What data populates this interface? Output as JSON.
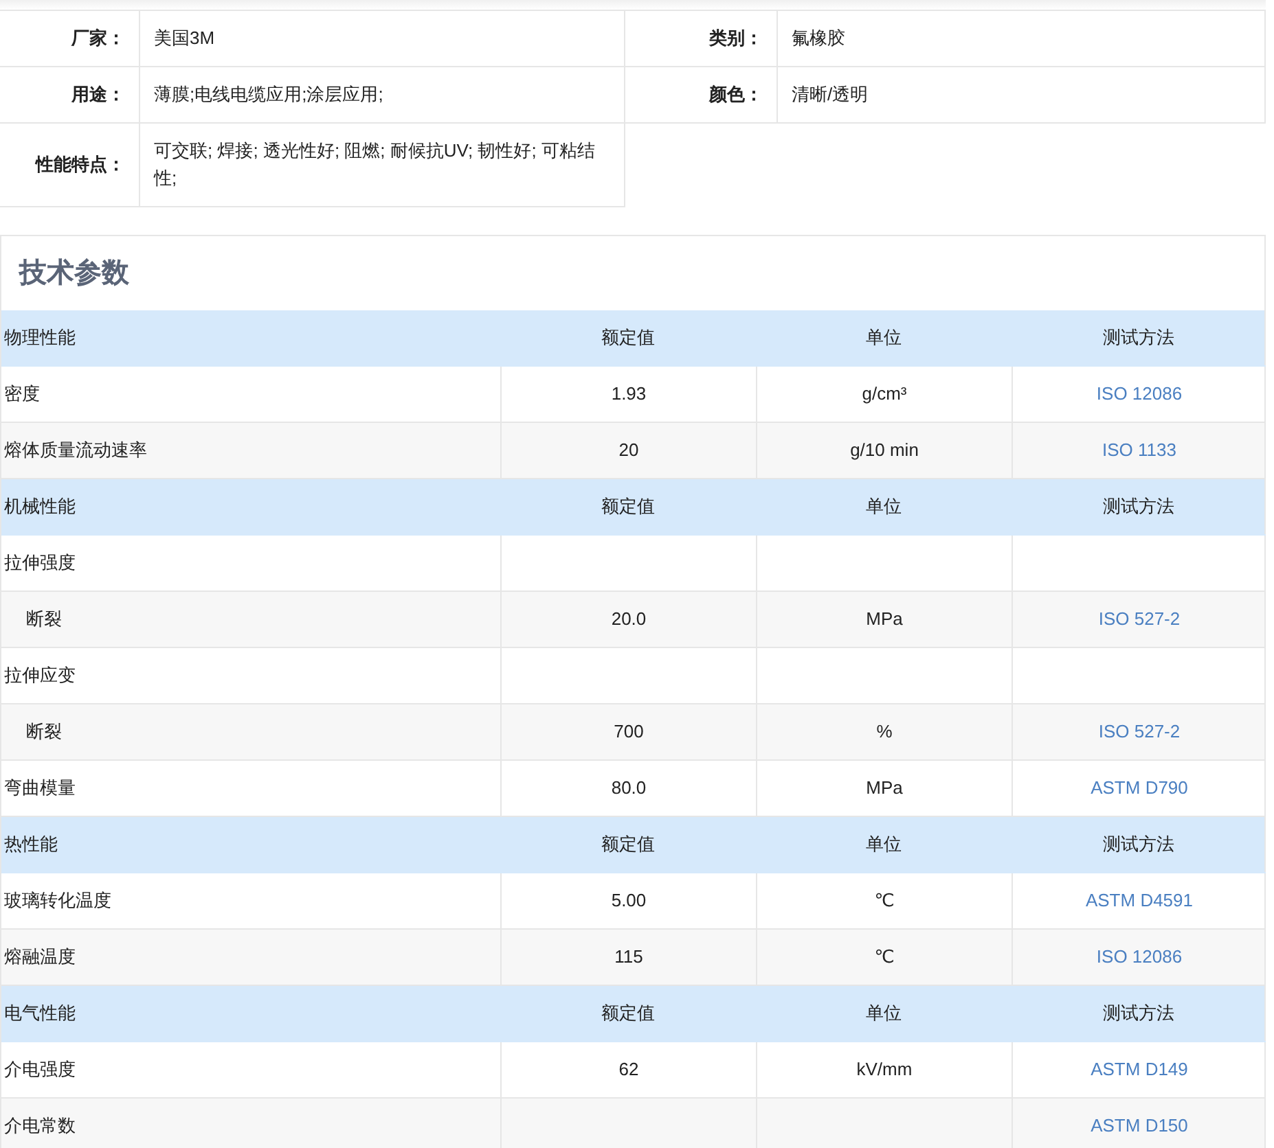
{
  "info": [
    {
      "label": "厂家：",
      "value": "美国3M"
    },
    {
      "label": "类别：",
      "value": "氟橡胶"
    },
    {
      "label": "用途：",
      "value": "薄膜;电线电缆应用;涂层应用;"
    },
    {
      "label": "颜色：",
      "value": "清晰/透明"
    },
    {
      "label": "性能特点：",
      "value": "可交联; 焊接; 透光性好; 阻燃; 耐候抗UV; 韧性好; 可粘结性;"
    }
  ],
  "params": {
    "title": "技术参数",
    "sections": [
      {
        "headers": [
          "物理性能",
          "额定值",
          "单位",
          "测试方法"
        ],
        "rows": [
          {
            "name": "密度",
            "value": "1.93",
            "unit": "g/cm³",
            "method": "ISO 12086"
          },
          {
            "name": "熔体质量流动速率",
            "value": "20",
            "unit": "g/10 min",
            "method": "ISO 1133"
          }
        ]
      },
      {
        "headers": [
          "机械性能",
          "额定值",
          "单位",
          "测试方法"
        ],
        "rows": [
          {
            "name": "拉伸强度",
            "children": [
              {
                "name": "断裂",
                "value": "20.0",
                "unit": "MPa",
                "method": "ISO 527-2"
              }
            ]
          },
          {
            "name": "拉伸应变",
            "children": [
              {
                "name": "断裂",
                "value": "700",
                "unit": "%",
                "method": "ISO 527-2"
              }
            ]
          },
          {
            "name": "弯曲模量",
            "value": "80.0",
            "unit": "MPa",
            "method": "ASTM D790"
          }
        ]
      },
      {
        "headers": [
          "热性能",
          "额定值",
          "单位",
          "测试方法"
        ],
        "rows": [
          {
            "name": "玻璃转化温度",
            "value": "5.00",
            "unit": "℃",
            "method": "ASTM D4591"
          },
          {
            "name": "熔融温度",
            "value": "115",
            "unit": "℃",
            "method": "ISO 12086"
          }
        ]
      },
      {
        "headers": [
          "电气性能",
          "额定值",
          "单位",
          "测试方法"
        ],
        "rows": [
          {
            "name": "介电强度",
            "value": "62",
            "unit": "kV/mm",
            "method": "ASTM D149"
          },
          {
            "name": "介电常数",
            "method": "ASTM D150"
          }
        ]
      }
    ]
  }
}
